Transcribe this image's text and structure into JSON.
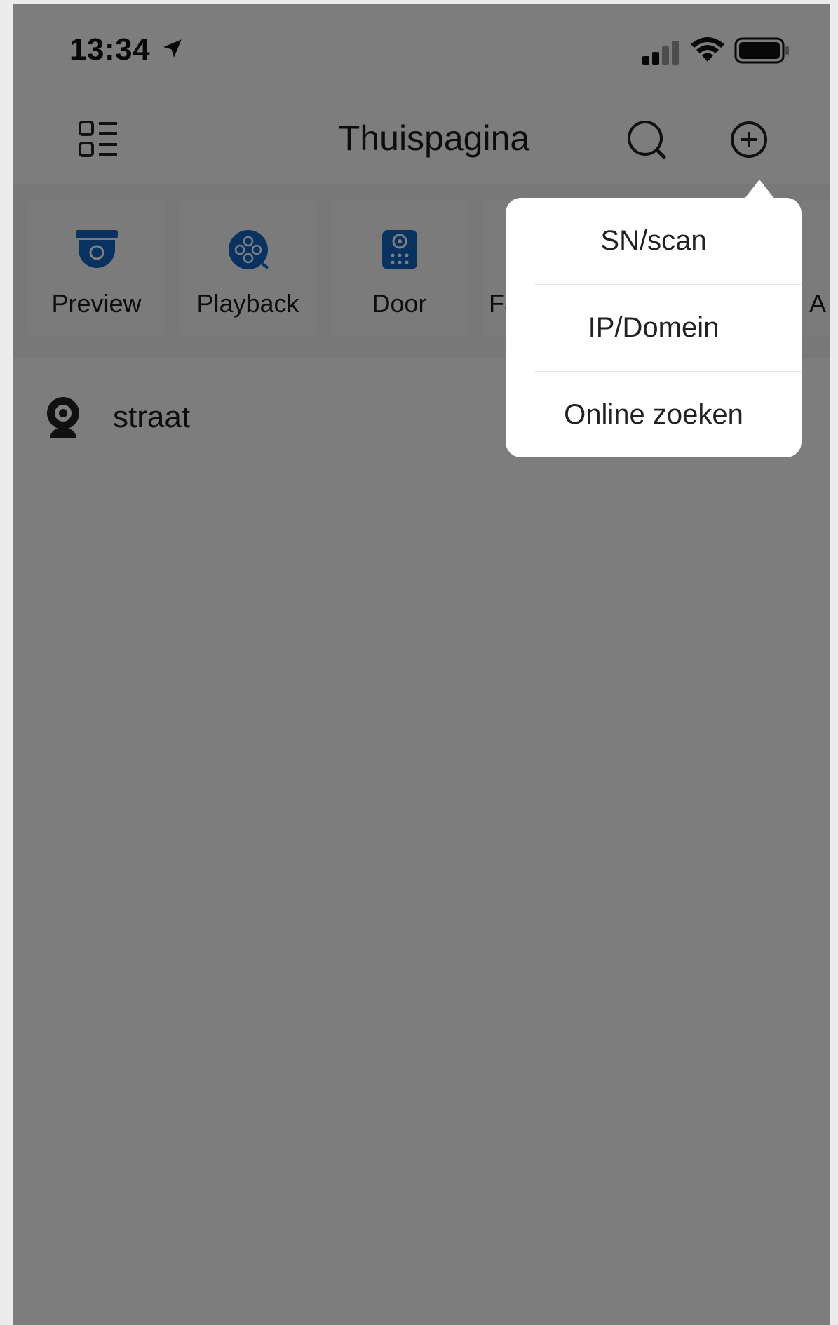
{
  "status_bar": {
    "time": "13:34",
    "icons": [
      "location-arrow-icon",
      "cellular-signal-icon",
      "wifi-icon",
      "battery-icon"
    ]
  },
  "nav": {
    "title": "Thuispagina",
    "icons": [
      "menu-list-icon",
      "search-icon",
      "add-circle-icon"
    ]
  },
  "shortcuts": [
    {
      "label": "Preview",
      "icon": "dome-camera-icon"
    },
    {
      "label": "Playback",
      "icon": "film-reel-icon"
    },
    {
      "label": "Door",
      "icon": "door-intercom-icon"
    },
    {
      "label": "Fa"
    },
    {
      "label": "A"
    }
  ],
  "devices": [
    {
      "name": "straat",
      "icon": "webcam-icon"
    }
  ],
  "popup_menu": {
    "items": [
      "SN/scan",
      "IP/Domein",
      "Online zoeken"
    ]
  },
  "colors": {
    "accent_blue": "#1565c0",
    "overlay": "rgba(0,0,0,0.5)"
  }
}
